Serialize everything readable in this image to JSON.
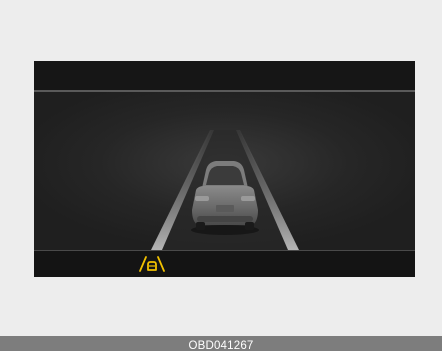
{
  "cluster": {
    "header": {},
    "road_view": {
      "lanes": "two-lines",
      "vehicle": "own-car-rear-view"
    },
    "footer": {
      "icon": "lane-following-assist-icon",
      "icon_color": "#f2c100"
    }
  },
  "caption": {
    "code": "OBD041267"
  },
  "colors": {
    "page_background": "#ededed",
    "display_background": "#1f1f1f",
    "caption_bar": "#7d7d7d",
    "indicator": "#f2c100"
  }
}
